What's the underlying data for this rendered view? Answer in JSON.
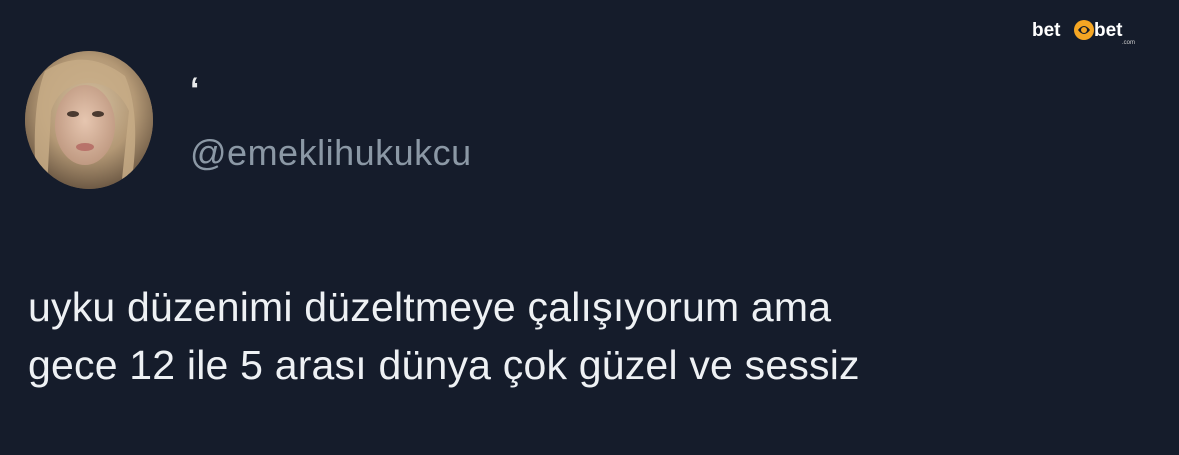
{
  "tweet": {
    "display_name": "‘",
    "handle": "@emeklihukukcu",
    "text_lines": [
      "uyku düzenimi düzeltmeye çalışıyorum ama",
      "gece 12 ile 5 arası dünya çok güzel ve sessiz"
    ]
  },
  "watermark": {
    "logo_text": "betebet",
    "part1": "bet",
    "part2": "bet",
    "suffix": ".com",
    "accent_color": "#f5a623"
  },
  "colors": {
    "background": "#151c2b",
    "text": "#eef1f4",
    "handle": "#8b98a5"
  },
  "icons": {
    "avatar": "profile-photo",
    "logo": "brand-logo"
  }
}
